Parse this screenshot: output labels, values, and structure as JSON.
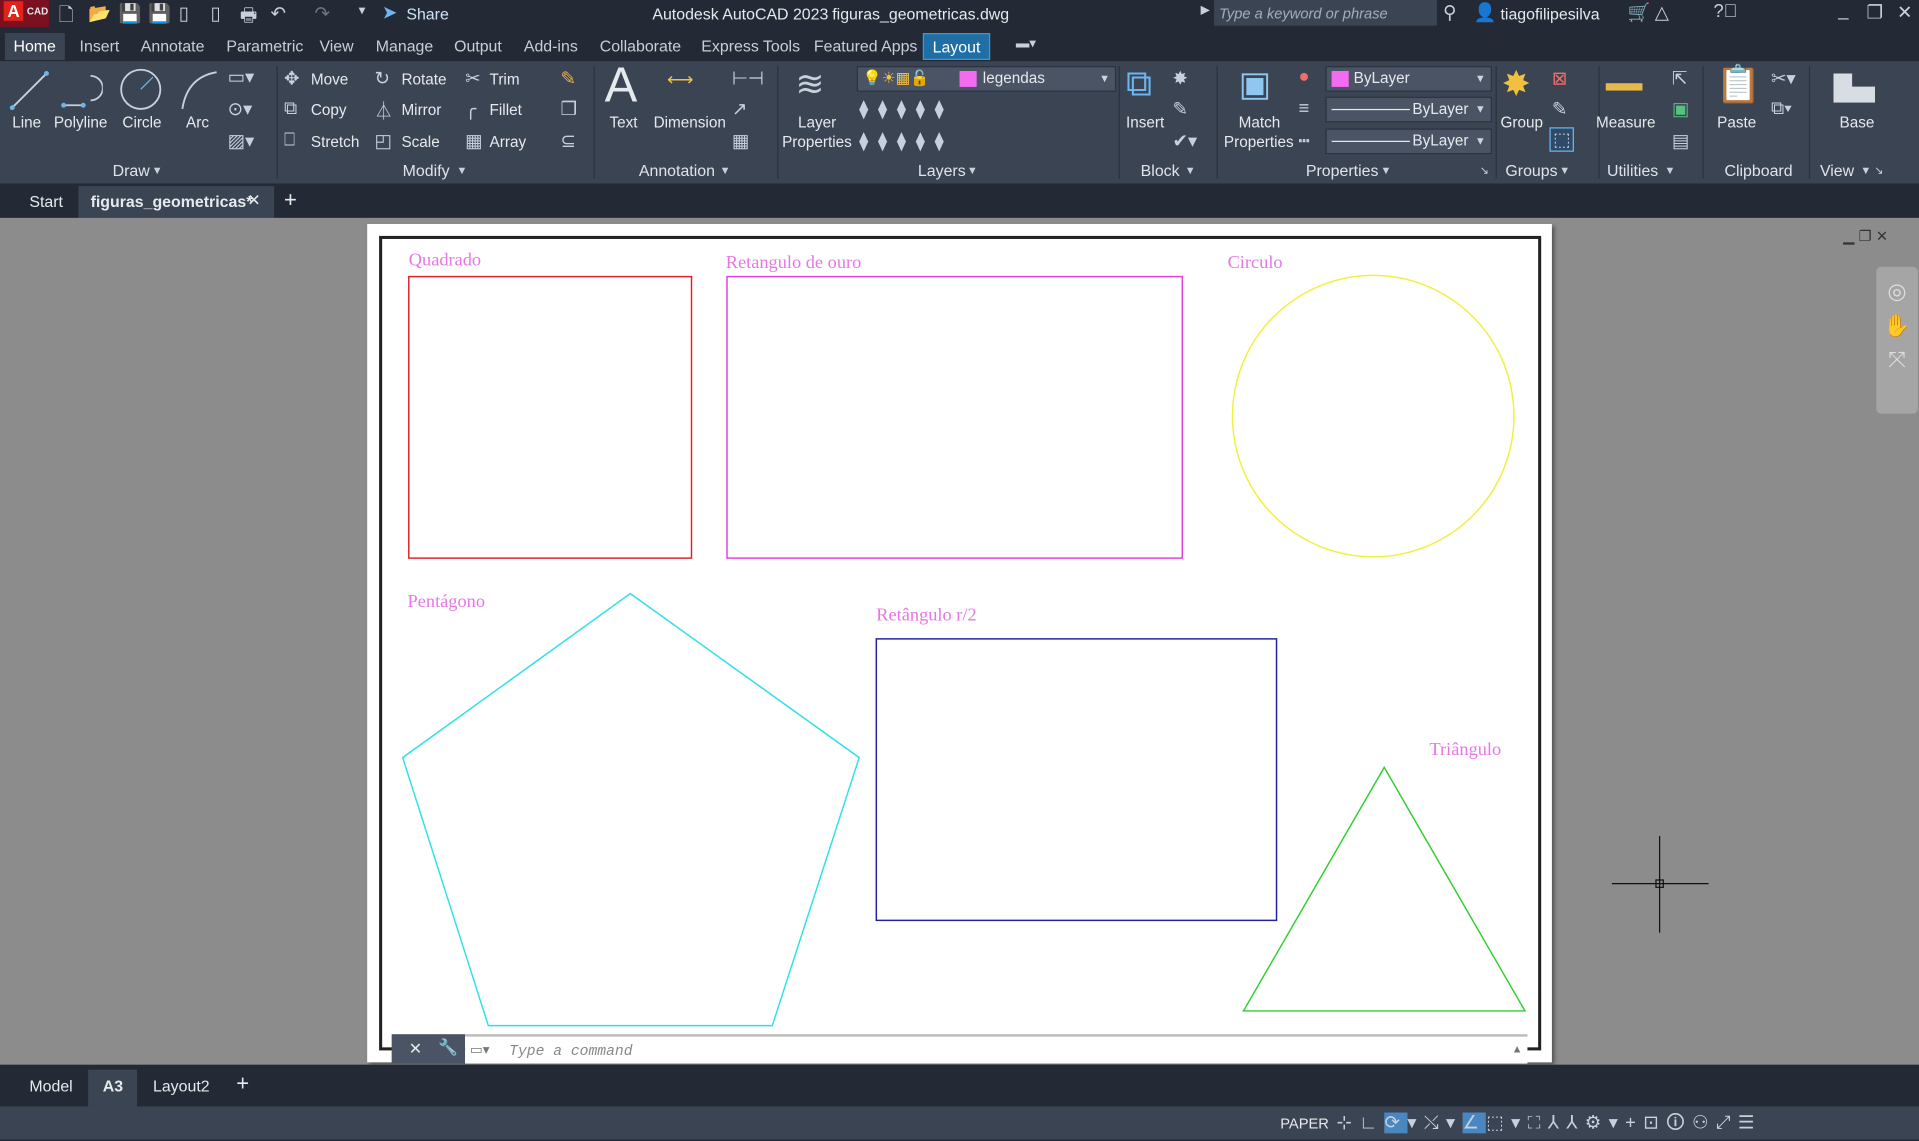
{
  "titlebar": {
    "app_badge": "A",
    "app_badge_sub": "CAD",
    "share": "Share",
    "title": "Autodesk AutoCAD 2023",
    "filename": "figuras_geometricas.dwg",
    "search_placeholder": "Type a keyword or phrase",
    "user": "tiagofilipesilva"
  },
  "ribbon_tabs": [
    "Home",
    "Insert",
    "Annotate",
    "Parametric",
    "View",
    "Manage",
    "Output",
    "Add-ins",
    "Collaborate",
    "Express Tools",
    "Featured Apps",
    "Layout"
  ],
  "draw": {
    "title": "Draw",
    "line": "Line",
    "polyline": "Polyline",
    "circle": "Circle",
    "arc": "Arc"
  },
  "modify": {
    "title": "Modify",
    "move": "Move",
    "rotate": "Rotate",
    "trim": "Trim",
    "copy": "Copy",
    "mirror": "Mirror",
    "fillet": "Fillet",
    "stretch": "Stretch",
    "scale": "Scale",
    "array": "Array"
  },
  "annotation": {
    "title": "Annotation",
    "text": "Text",
    "dimension": "Dimension"
  },
  "layers": {
    "title": "Layers",
    "layer_properties_1": "Layer",
    "layer_properties_2": "Properties",
    "current_layer": "legendas"
  },
  "block": {
    "title": "Block",
    "insert": "Insert"
  },
  "properties": {
    "title": "Properties",
    "match_1": "Match",
    "match_2": "Properties",
    "color": "ByLayer",
    "lineweight": "ByLayer",
    "linetype": "ByLayer"
  },
  "groups": {
    "title": "Groups",
    "group": "Group"
  },
  "utilities": {
    "title": "Utilities",
    "measure": "Measure"
  },
  "clipboard": {
    "title": "Clipboard",
    "paste": "Paste"
  },
  "view": {
    "title": "View",
    "base": "Base"
  },
  "doc_tabs": {
    "start": "Start",
    "active": "figuras_geometricas*"
  },
  "drawing": {
    "quadrado": "Quadrado",
    "retangulo_ouro": "Retangulo de ouro",
    "circulo": "Circulo",
    "pentagono": "Pentágono",
    "retangulo_r2": "Retângulo r/2",
    "triangulo": "Triângulo"
  },
  "command": {
    "placeholder": "Type a command"
  },
  "layout_tabs": [
    "Model",
    "A3",
    "Layout2"
  ],
  "status": {
    "paper": "PAPER"
  },
  "colors": {
    "quadrado": "#e0202a",
    "retangulo_ouro": "#e040e0",
    "circulo": "#f0f040",
    "pentagono": "#30e0e8",
    "retangulo_r2": "#2020a0",
    "triangulo": "#30d030",
    "label": "#e676e6"
  }
}
